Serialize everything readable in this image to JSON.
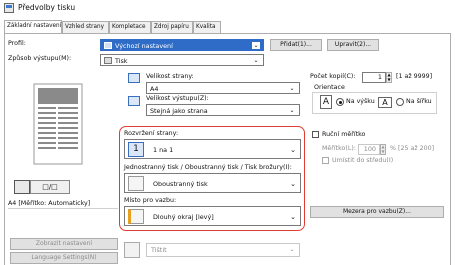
{
  "window": {
    "title": "Předvolby tisku"
  },
  "tabs": [
    {
      "label": "Základní nastavení",
      "active": true
    },
    {
      "label": "Vzhled strany",
      "active": false
    },
    {
      "label": "Kompletace",
      "active": false
    },
    {
      "label": "Zdroj papíru",
      "active": false
    },
    {
      "label": "Kvalita",
      "active": false
    }
  ],
  "profile": {
    "label": "Profil:",
    "value": "Výchozí nastavení",
    "add_button": "Přidat(1)...",
    "edit_button": "Upravit(2)..."
  },
  "output_method": {
    "label": "Způsob výstupu(M):",
    "value": "Tisk"
  },
  "preview": {
    "caption": "A4 [Měřítko: Automaticky]",
    "view_settings_button": "Zobrazit nastavení",
    "language_button": "Language Settings(N)"
  },
  "page_size": {
    "label": "Velikost strany:",
    "value": "A4"
  },
  "output_size": {
    "label": "Velikost výstupu(Z):",
    "value": "Stejná jako strana"
  },
  "copies": {
    "label": "Počet kopií(C):",
    "value": "1",
    "range": "[1 až 9999]"
  },
  "orientation": {
    "label": "Orientace",
    "options": [
      "Na výšku",
      "Na šířku"
    ],
    "selected": 0
  },
  "layout": {
    "label": "Rozvržení strany:",
    "value": "1 na 1",
    "icon_text": "1"
  },
  "duplex": {
    "label": "Jednostranný tisk / Oboustranný tisk / Tisk brožury(I):",
    "value": "Oboustranný tisk"
  },
  "binding": {
    "label": "Místo pro vazbu:",
    "value": "Dlouhý okraj [levý]"
  },
  "scaling": {
    "label": "Ruční měřítko",
    "scale_label": "Měřítko(L):",
    "scale_value": "100",
    "scale_range": "% [25 až 200]"
  },
  "edge": {
    "label": "Umístit do středu(I)"
  },
  "binding_button": "Mezera pro vazbu(Z)...",
  "color_mode": {
    "value": "Tištit"
  }
}
